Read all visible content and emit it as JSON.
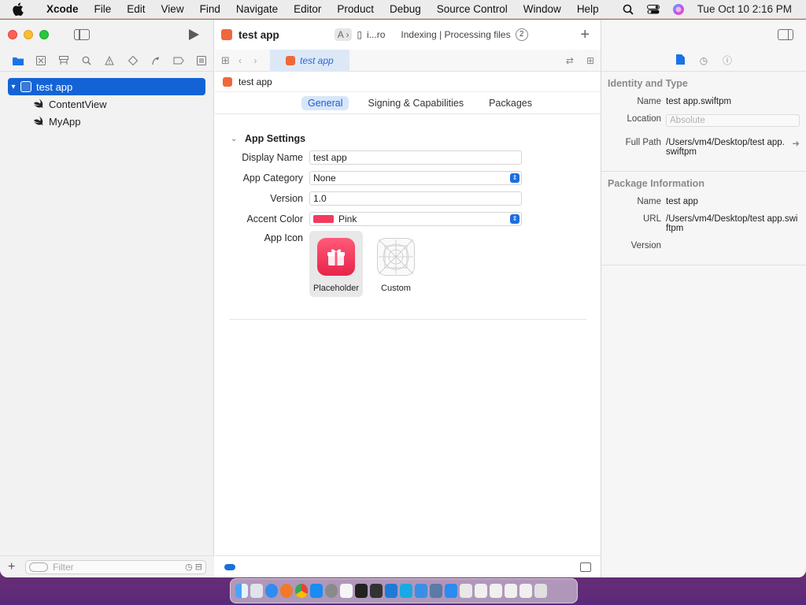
{
  "menubar": {
    "app_name": "Xcode",
    "items": [
      "File",
      "Edit",
      "View",
      "Find",
      "Navigate",
      "Editor",
      "Product",
      "Debug",
      "Source Control",
      "Window",
      "Help"
    ],
    "clock": "Tue Oct 10  2:16 PM"
  },
  "navigator": {
    "project_name": "test app",
    "children": [
      "ContentView",
      "MyApp"
    ],
    "filter_placeholder": "Filter"
  },
  "editor": {
    "window_title": "test app",
    "scheme": "i...ro",
    "activity": "Indexing | Processing files",
    "activity_count": "2",
    "tab_label": "test app",
    "breadcrumb": "test app",
    "tabs": [
      "General",
      "Signing & Capabilities",
      "Packages"
    ],
    "section_title": "App Settings",
    "fields": {
      "display_name_label": "Display Name",
      "display_name_value": "test app",
      "app_category_label": "App Category",
      "app_category_value": "None",
      "version_label": "Version",
      "version_value": "1.0",
      "accent_color_label": "Accent Color",
      "accent_color_value": "Pink",
      "app_icon_label": "App Icon"
    },
    "icon_options": [
      "Placeholder",
      "Custom"
    ]
  },
  "inspector": {
    "identity_title": "Identity and Type",
    "name_label": "Name",
    "name_value": "test app.swiftpm",
    "location_label": "Location",
    "location_value": "Absolute",
    "full_path_label": "Full Path",
    "full_path_value": "/Users/vm4/Desktop/test app.swiftpm",
    "package_title": "Package Information",
    "pkg_name_label": "Name",
    "pkg_name_value": "test app",
    "url_label": "URL",
    "url_value": "/Users/vm4/Desktop/test app.swiftpm",
    "version_label": "Version"
  },
  "colors": {
    "accent": "#1463d6",
    "pink": "#f23a5e"
  }
}
